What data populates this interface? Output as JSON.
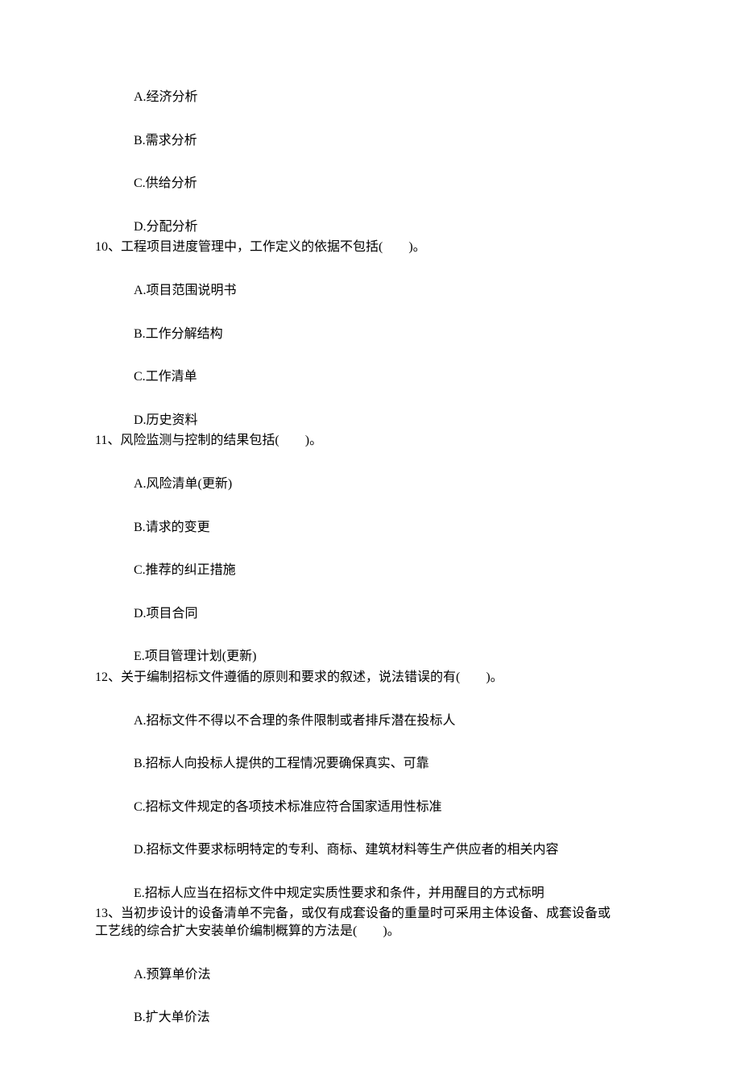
{
  "q9": {
    "optA": "A.经济分析",
    "optB": "B.需求分析",
    "optC": "C.供给分析",
    "optD": "D.分配分析"
  },
  "q10": {
    "stem": "10、工程项目进度管理中，工作定义的依据不包括(　　)。",
    "optA": "A.项目范围说明书",
    "optB": "B.工作分解结构",
    "optC": "C.工作清单",
    "optD": "D.历史资料"
  },
  "q11": {
    "stem": "11、风险监测与控制的结果包括(　　)。",
    "optA": "A.风险清单(更新)",
    "optB": "B.请求的变更",
    "optC": "C.推荐的纠正措施",
    "optD": "D.项目合同",
    "optE": "E.项目管理计划(更新)"
  },
  "q12": {
    "stem": "12、关于编制招标文件遵循的原则和要求的叙述，说法错误的有(　　)。",
    "optA": "A.招标文件不得以不合理的条件限制或者排斥潜在投标人",
    "optB": "B.招标人向投标人提供的工程情况要确保真实、可靠",
    "optC": "C.招标文件规定的各项技术标准应符合国家适用性标准",
    "optD": "D.招标文件要求标明特定的专利、商标、建筑材料等生产供应者的相关内容",
    "optE": "E.招标人应当在招标文件中规定实质性要求和条件，并用醒目的方式标明"
  },
  "q13": {
    "stem_line1": "13、当初步设计的设备清单不完备，或仅有成套设备的重量时可采用主体设备、成套设备或",
    "stem_line2": "工艺线的综合扩大安装单价编制概算的方法是(　　)。",
    "optA": "A.预算单价法",
    "optB": "B.扩大单价法"
  }
}
